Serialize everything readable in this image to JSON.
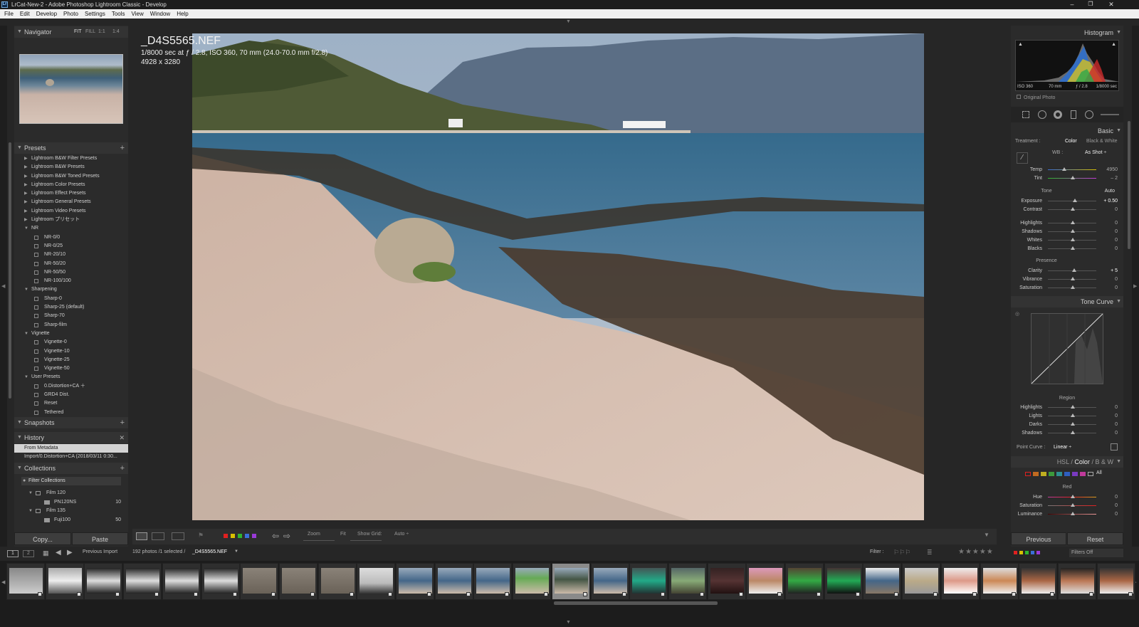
{
  "titlebar": {
    "title": "LrCat-New-2 - Adobe Photoshop Lightroom Classic - Develop",
    "icon": "lr-app-icon",
    "minimize": "–",
    "restore": "❐",
    "close": "✕"
  },
  "menu": [
    "File",
    "Edit",
    "Develop",
    "Photo",
    "Settings",
    "Tools",
    "View",
    "Window",
    "Help"
  ],
  "navigator": {
    "title": "Navigator",
    "options": [
      "FIT",
      "FILL",
      "1:1",
      "1:4"
    ]
  },
  "presets": {
    "title": "Presets",
    "groups": [
      "Lightroom B&W Filter Presets",
      "Lightroom B&W Presets",
      "Lightroom B&W Toned Presets",
      "Lightroom Color Presets",
      "Lightroom Effect Presets",
      "Lightroom General Presets",
      "Lightroom Video Presets",
      "Lightroom プリセット"
    ],
    "nr": {
      "label": "NR",
      "items": [
        "NR-0/0",
        "NR-0/25",
        "NR-20/10",
        "NR-50/20",
        "NR-50/50",
        "NR-100/100"
      ]
    },
    "sharpening": {
      "label": "Sharpening",
      "items": [
        "Sharp-0",
        "Sharp-25 (default)",
        "Sharp-70",
        "Sharp-film"
      ]
    },
    "vignette": {
      "label": "Vignette",
      "items": [
        "Vignette-0",
        "Vignette-10",
        "Vignette-25",
        "Vignette-50"
      ]
    },
    "user": {
      "label": "User Presets",
      "items": [
        "0.Distortion+CA ＋",
        "GRD4 Dist.",
        "Reset",
        "Tethered"
      ]
    }
  },
  "snapshots": {
    "title": "Snapshots"
  },
  "history": {
    "title": "History",
    "items": [
      "From Metadata",
      "Import/0.Distortion+CA (2018/03/11 0:30..."
    ]
  },
  "collections": {
    "title": "Collections",
    "filter": "Filter Collections",
    "items": [
      {
        "name": "Film 120",
        "count": ""
      },
      {
        "name": "PN120NS",
        "count": "10"
      },
      {
        "name": "Film 135",
        "count": ""
      },
      {
        "name": "Fuji100",
        "count": "50"
      }
    ]
  },
  "leftbuttons": {
    "copy": "Copy...",
    "paste": "Paste"
  },
  "photo": {
    "filename": "_D4S5565.NEF",
    "exif": "1/8000 sec at ƒ / 2.8, ISO 360, 70 mm (24.0-70.0 mm f/2.8)",
    "dims": "4928 x 3280"
  },
  "toolbar": {
    "zoom": "Zoom",
    "fit": "Fit",
    "showgrid": "Show Grid:",
    "auto": "Auto ÷"
  },
  "histogram": {
    "title": "Histogram",
    "iso": "ISO 360",
    "focal": "70 mm",
    "aperture": "ƒ / 2.8",
    "shutter": "1/8000 sec",
    "original": "Original Photo"
  },
  "basic": {
    "title": "Basic",
    "treatment": "Treatment :",
    "color": "Color",
    "bw": "Black & White",
    "wb": "WB :",
    "wbvalue": "As Shot ÷",
    "temp": {
      "label": "Temp",
      "value": "4950"
    },
    "tint": {
      "label": "Tint",
      "value": "– 2"
    },
    "tone": "Tone",
    "auto": "Auto",
    "exposure": {
      "label": "Exposure",
      "value": "+ 0.50"
    },
    "contrast": {
      "label": "Contrast",
      "value": "0"
    },
    "highlights": {
      "label": "Highlights",
      "value": "0"
    },
    "shadows": {
      "label": "Shadows",
      "value": "0"
    },
    "whites": {
      "label": "Whites",
      "value": "0"
    },
    "blacks": {
      "label": "Blacks",
      "value": "0"
    },
    "presence": "Presence",
    "clarity": {
      "label": "Clarity",
      "value": "+ 5"
    },
    "vibrance": {
      "label": "Vibrance",
      "value": "0"
    },
    "saturation": {
      "label": "Saturation",
      "value": "0"
    }
  },
  "tonecurve": {
    "title": "Tone Curve",
    "region": "Region",
    "highlights": {
      "label": "Highlights",
      "value": "0"
    },
    "lights": {
      "label": "Lights",
      "value": "0"
    },
    "darks": {
      "label": "Darks",
      "value": "0"
    },
    "shadows": {
      "label": "Shadows",
      "value": "0"
    },
    "pointcurve": "Point Curve :",
    "pointvalue": "Linear ÷"
  },
  "hsl": {
    "hsl": "HSL",
    "sep1": "/",
    "color": "Color",
    "sep2": "/",
    "bw": "B & W",
    "all": "All",
    "red": "Red",
    "hue": {
      "label": "Hue",
      "value": "0"
    },
    "saturation": {
      "label": "Saturation",
      "value": "0"
    },
    "luminance": {
      "label": "Luminance",
      "value": "0"
    }
  },
  "rightbuttons": {
    "previous": "Previous",
    "reset": "Reset"
  },
  "filmstrip": {
    "source": "Previous Import",
    "count": "192 photos /1 selected /",
    "selected": "_D4S5565.NEF",
    "filter": "Filter :",
    "filtersoff": "Filters Off",
    "page1": "1",
    "page2": "2",
    "stars": "★★★★★"
  },
  "colors": {
    "accent": "#4a90d9",
    "label_red": "#e02020",
    "label_yellow": "#d8c000",
    "label_green": "#2fb52f",
    "label_blue": "#3a6fd8",
    "label_purple": "#9a3ad8"
  }
}
